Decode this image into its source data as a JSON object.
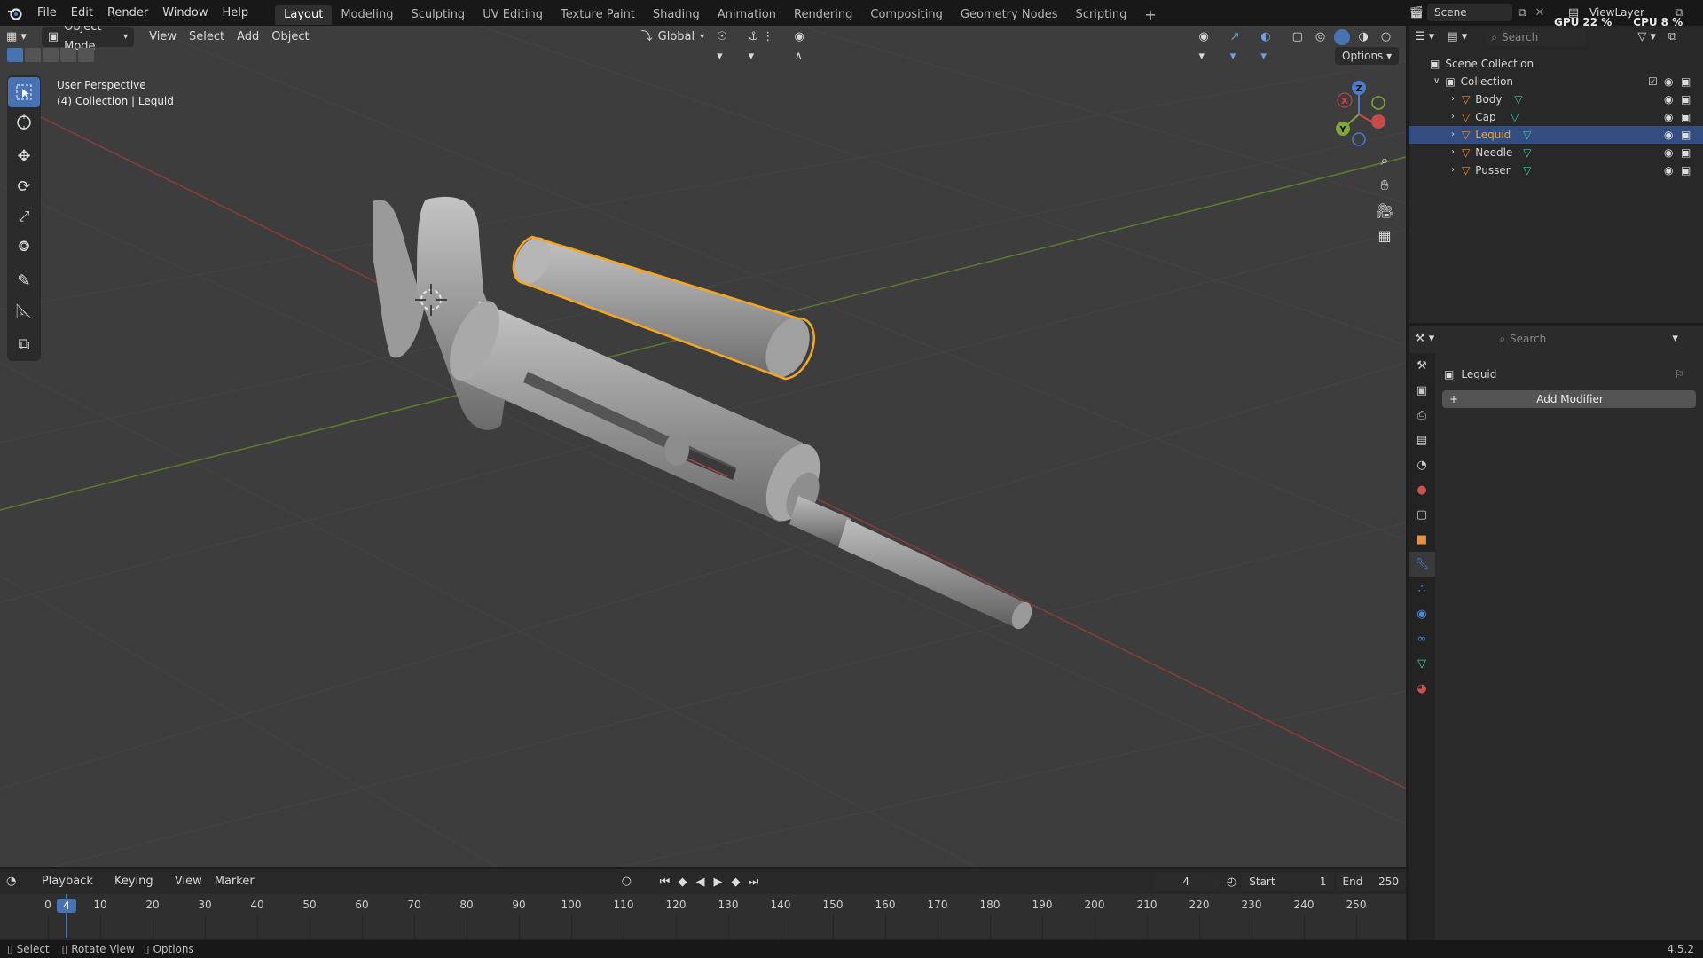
{
  "topbar": {
    "menus": [
      "File",
      "Edit",
      "Render",
      "Window",
      "Help"
    ],
    "workspaces": [
      "Layout",
      "Modeling",
      "Sculpting",
      "UV Editing",
      "Texture Paint",
      "Shading",
      "Animation",
      "Rendering",
      "Compositing",
      "Geometry Nodes",
      "Scripting"
    ],
    "active_workspace": "Layout",
    "scene_name": "Scene",
    "view_layer": "ViewLayer",
    "gpu_label": "GPU",
    "gpu_value": "22 %",
    "cpu_label": "CPU",
    "cpu_value": "8 %"
  },
  "viewport": {
    "mode": "Object Mode",
    "menus": [
      "View",
      "Select",
      "Add",
      "Object"
    ],
    "orientation": "Global",
    "options_label": "Options",
    "overlay_title": "User Perspective",
    "overlay_subtitle": "(4) Collection | Lequid",
    "gizmo": {
      "z": "Z",
      "x": "X",
      "y": "Y"
    }
  },
  "outliner": {
    "search_placeholder": "Search",
    "scene_collection": "Scene Collection",
    "collection": "Collection",
    "objects": [
      {
        "name": "Body",
        "selected": false
      },
      {
        "name": "Cap",
        "selected": false
      },
      {
        "name": "Lequid",
        "selected": true
      },
      {
        "name": "Needle",
        "selected": false
      },
      {
        "name": "Pusser",
        "selected": false
      }
    ]
  },
  "properties": {
    "search_placeholder": "Search",
    "object_name": "Lequid",
    "add_modifier_label": "Add Modifier"
  },
  "timeline": {
    "menus": [
      "Playback",
      "Keying",
      "View",
      "Marker"
    ],
    "current_frame": "4",
    "start_label": "Start",
    "start_value": "1",
    "end_label": "End",
    "end_value": "250",
    "ticks": [
      "0",
      "10",
      "20",
      "30",
      "40",
      "50",
      "60",
      "70",
      "80",
      "90",
      "100",
      "110",
      "120",
      "130",
      "140",
      "150",
      "160",
      "170",
      "180",
      "190",
      "200",
      "210",
      "220",
      "230",
      "240",
      "250"
    ]
  },
  "statusbar": {
    "select": "Select",
    "rotate": "Rotate View",
    "options": "Options",
    "version": "4.5.2"
  },
  "colors": {
    "accent": "#4772b3",
    "selection_outline": "#f5a623",
    "x_axis": "#c94a4a",
    "y_axis": "#7ea83a"
  }
}
